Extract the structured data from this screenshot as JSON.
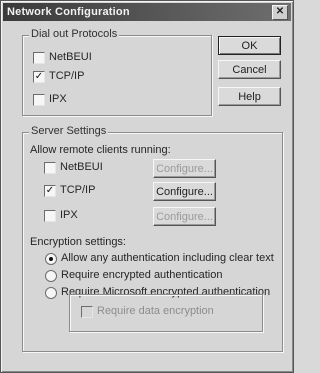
{
  "window": {
    "title": "Network Configuration",
    "close_glyph": "✕"
  },
  "dialout": {
    "label": "Dial out Protocols",
    "items": [
      {
        "label": "NetBEUI",
        "checked": false
      },
      {
        "label": "TCP/IP",
        "checked": true
      },
      {
        "label": "IPX",
        "checked": false
      }
    ]
  },
  "buttons": {
    "ok": "OK",
    "cancel": "Cancel",
    "help": "Help"
  },
  "server": {
    "label": "Server Settings",
    "allow_label": "Allow remote clients running:",
    "items": [
      {
        "label": "NetBEUI",
        "checked": false,
        "configure": "Configure..."
      },
      {
        "label": "TCP/IP",
        "checked": true,
        "configure": "Configure..."
      },
      {
        "label": "IPX",
        "checked": false,
        "configure": "Configure..."
      }
    ],
    "encryption_label": "Encryption settings:",
    "encryption_options": [
      {
        "label": "Allow any authentication including clear text",
        "selected": true
      },
      {
        "label": "Require encrypted authentication",
        "selected": false
      },
      {
        "label": "Require Microsoft encrypted authentication",
        "selected": false
      }
    ],
    "require_data_encryption": "Require data encryption"
  },
  "colors": {
    "face": "#d6d6d6",
    "titlebar": "#3a3a3a"
  }
}
